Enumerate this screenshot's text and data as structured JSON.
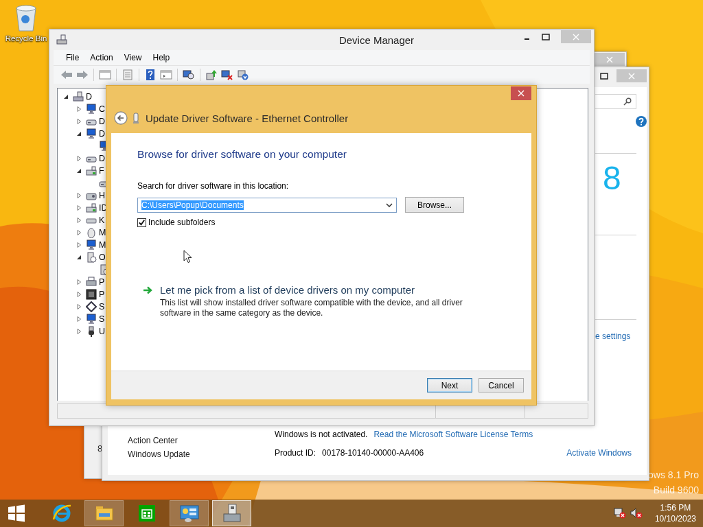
{
  "desktop": {
    "icons": [
      {
        "label": "Recycle Bin"
      }
    ],
    "watermark": [
      "ows 8.1 Pro",
      "Build 9600"
    ]
  },
  "behind_window": {
    "text": "8"
  },
  "system_window": {
    "logo_text": "8",
    "settings_link": "e settings",
    "see_also": [
      "Action Center",
      "Windows Update"
    ],
    "activation": {
      "status": "Windows is not activated.",
      "license_link": "Read the Microsoft Software License Terms",
      "product_id_label": "Product ID:",
      "product_id": "00178-10140-00000-AA406",
      "activate_link": "Activate Windows"
    }
  },
  "device_manager": {
    "title": "Device Manager",
    "menu": [
      "File",
      "Action",
      "View",
      "Help"
    ],
    "tree": [
      {
        "label": "D",
        "kind": "pc",
        "expanded": true,
        "children": [
          {
            "label": "C",
            "kind": "monitor",
            "expanded": false
          },
          {
            "label": "D",
            "kind": "drive",
            "expanded": false
          },
          {
            "label": "D",
            "kind": "monitor",
            "expanded": true,
            "children": [
              {
                "kind": "monitor"
              }
            ]
          },
          {
            "label": "D",
            "kind": "dvd",
            "expanded": false
          },
          {
            "label": "F",
            "kind": "controller",
            "expanded": true,
            "children": [
              {
                "kind": "drive"
              }
            ]
          },
          {
            "label": "H",
            "kind": "hid",
            "expanded": false
          },
          {
            "label": "ID",
            "kind": "controller",
            "expanded": false
          },
          {
            "label": "K",
            "kind": "keyboard",
            "expanded": false
          },
          {
            "label": "M",
            "kind": "mouse",
            "expanded": false
          },
          {
            "label": "M",
            "kind": "monitor",
            "expanded": false
          },
          {
            "label": "O",
            "kind": "device",
            "expanded": true,
            "children": [
              {
                "kind": "device"
              }
            ]
          },
          {
            "label": "P",
            "kind": "printer",
            "expanded": false
          },
          {
            "label": "P",
            "kind": "chip",
            "expanded": false
          },
          {
            "label": "S",
            "kind": "software",
            "expanded": false
          },
          {
            "label": "S",
            "kind": "monitor",
            "expanded": false
          },
          {
            "label": "U",
            "kind": "usb",
            "expanded": false
          }
        ]
      }
    ]
  },
  "dialog": {
    "title": "Update Driver Software - Ethernet Controller",
    "heading": "Browse for driver software on your computer",
    "location_label": "Search for driver software in this location:",
    "location_value": "C:\\Users\\Popup\\Documents",
    "browse_button": "Browse...",
    "include_subfolders": {
      "label": "Include subfolders",
      "checked": true
    },
    "pick_link": {
      "title": "Let me pick from a list of device drivers on my computer",
      "description": "This list will show installed driver software compatible with the device, and all driver software in the same category as the device."
    },
    "buttons": [
      {
        "label": "Next",
        "default": true
      },
      {
        "label": "Cancel",
        "default": false
      }
    ]
  },
  "taskbar": {
    "apps": [
      {
        "kind": "browser",
        "running": false,
        "active": false
      },
      {
        "kind": "explorer",
        "running": true,
        "active": false
      },
      {
        "kind": "store",
        "running": false,
        "active": false
      },
      {
        "kind": "control-panel",
        "running": true,
        "active": false
      },
      {
        "kind": "device-manager",
        "running": true,
        "active": true
      }
    ],
    "time": "1:56 PM",
    "date": "10/10/2023"
  }
}
